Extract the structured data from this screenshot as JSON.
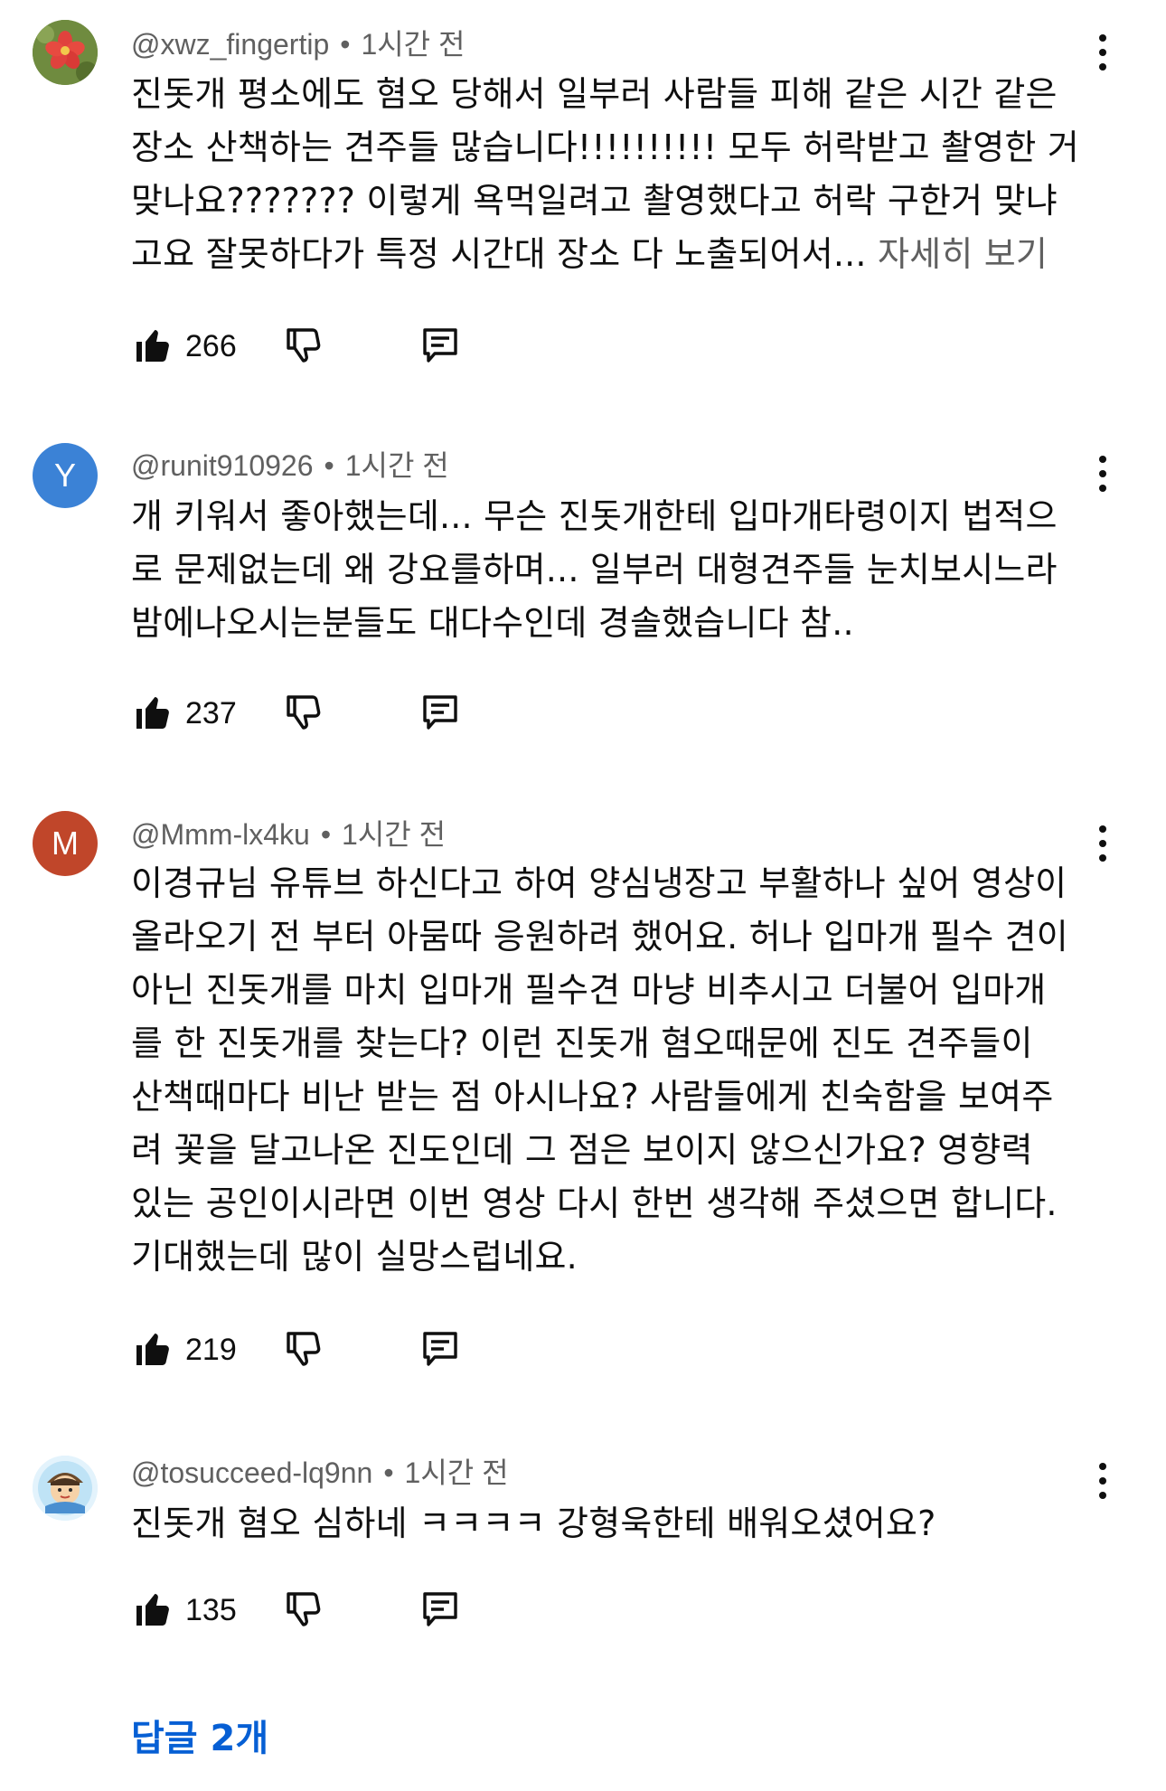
{
  "comments": [
    {
      "handle": "@xwz_fingertip",
      "time": "1시간 전",
      "avatar_letter": "",
      "avatar_icon": "flower-avatar",
      "lines": [
        "진돗개 평소에도 혐오 당해서 일부러 사람들 피해 같은 시간 같은",
        "장소 산책하는 견주들 많습니다!!!!!!!!!! 모두 허락받고 촬영한 거",
        "맞나요??????? 이렇게 욕먹일려고 촬영했다고 허락 구한거 맞냐",
        "고요 잘못하다가 특정 시간대 장소 다 노출되어서..."
      ],
      "more_label": "자세히 보기",
      "likes": "266"
    },
    {
      "handle": "@runit910926",
      "time": "1시간 전",
      "avatar_letter": "Y",
      "avatar_color": "#3b82d6",
      "lines": [
        "개 키워서 좋아했는데... 무슨 진돗개한테 입마개타령이지 법적으",
        "로 문제없는데 왜 강요를하며... 일부러 대형견주들 눈치보시느라",
        "밤에나오시는분들도 대다수인데 경솔했습니다 참.."
      ],
      "likes": "237"
    },
    {
      "handle": "@Mmm-lx4ku",
      "time": "1시간 전",
      "avatar_letter": "M",
      "avatar_color": "#c0462a",
      "lines": [
        "이경규님 유튜브 하신다고 하여 양심냉장고 부활하나 싶어 영상이",
        "올라오기 전 부터 아뭄따 응원하려 했어요. 허나 입마개 필수 견이",
        "아닌 진돗개를 마치 입마개 필수견 마냥 비추시고 더불어 입마개",
        "를 한 진돗개를 찾는다? 이런 진돗개 혐오때문에 진도 견주들이",
        "산책때마다 비난 받는 점 아시나요? 사람들에게 친숙함을 보여주",
        "려 꽃을 달고나온 진도인데 그 점은 보이지 않으신가요? 영향력",
        "있는 공인이시라면 이번 영상 다시 한번 생각해 주셨으면 합니다.",
        "기대했는데 많이 실망스럽네요."
      ],
      "likes": "219"
    },
    {
      "handle": "@tosucceed-lq9nn",
      "time": "1시간 전",
      "avatar_letter": "",
      "avatar_icon": "cartoon-avatar",
      "lines": [
        "진돗개 혐오 심하네 ㅋㅋㅋㅋ 강형욱한테 배워오셨어요?"
      ],
      "likes": "135"
    }
  ],
  "replies_label": "답글 2개",
  "colors": {
    "accent": "#065fd4",
    "secondary_text": "#606060",
    "primary_text": "#0f0f0f"
  }
}
